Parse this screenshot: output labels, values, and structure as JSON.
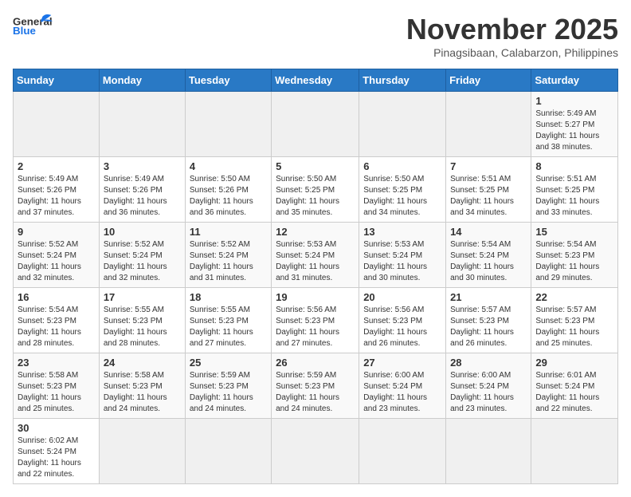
{
  "header": {
    "logo_general": "General",
    "logo_blue": "Blue",
    "month_title": "November 2025",
    "location": "Pinagsibaan, Calabarzon, Philippines"
  },
  "days_of_week": [
    "Sunday",
    "Monday",
    "Tuesday",
    "Wednesday",
    "Thursday",
    "Friday",
    "Saturday"
  ],
  "weeks": [
    [
      {
        "day": "",
        "info": ""
      },
      {
        "day": "",
        "info": ""
      },
      {
        "day": "",
        "info": ""
      },
      {
        "day": "",
        "info": ""
      },
      {
        "day": "",
        "info": ""
      },
      {
        "day": "",
        "info": ""
      },
      {
        "day": "1",
        "info": "Sunrise: 5:49 AM\nSunset: 5:27 PM\nDaylight: 11 hours\nand 38 minutes."
      }
    ],
    [
      {
        "day": "2",
        "info": "Sunrise: 5:49 AM\nSunset: 5:26 PM\nDaylight: 11 hours\nand 37 minutes."
      },
      {
        "day": "3",
        "info": "Sunrise: 5:49 AM\nSunset: 5:26 PM\nDaylight: 11 hours\nand 36 minutes."
      },
      {
        "day": "4",
        "info": "Sunrise: 5:50 AM\nSunset: 5:26 PM\nDaylight: 11 hours\nand 36 minutes."
      },
      {
        "day": "5",
        "info": "Sunrise: 5:50 AM\nSunset: 5:25 PM\nDaylight: 11 hours\nand 35 minutes."
      },
      {
        "day": "6",
        "info": "Sunrise: 5:50 AM\nSunset: 5:25 PM\nDaylight: 11 hours\nand 34 minutes."
      },
      {
        "day": "7",
        "info": "Sunrise: 5:51 AM\nSunset: 5:25 PM\nDaylight: 11 hours\nand 34 minutes."
      },
      {
        "day": "8",
        "info": "Sunrise: 5:51 AM\nSunset: 5:25 PM\nDaylight: 11 hours\nand 33 minutes."
      }
    ],
    [
      {
        "day": "9",
        "info": "Sunrise: 5:52 AM\nSunset: 5:24 PM\nDaylight: 11 hours\nand 32 minutes."
      },
      {
        "day": "10",
        "info": "Sunrise: 5:52 AM\nSunset: 5:24 PM\nDaylight: 11 hours\nand 32 minutes."
      },
      {
        "day": "11",
        "info": "Sunrise: 5:52 AM\nSunset: 5:24 PM\nDaylight: 11 hours\nand 31 minutes."
      },
      {
        "day": "12",
        "info": "Sunrise: 5:53 AM\nSunset: 5:24 PM\nDaylight: 11 hours\nand 31 minutes."
      },
      {
        "day": "13",
        "info": "Sunrise: 5:53 AM\nSunset: 5:24 PM\nDaylight: 11 hours\nand 30 minutes."
      },
      {
        "day": "14",
        "info": "Sunrise: 5:54 AM\nSunset: 5:24 PM\nDaylight: 11 hours\nand 30 minutes."
      },
      {
        "day": "15",
        "info": "Sunrise: 5:54 AM\nSunset: 5:23 PM\nDaylight: 11 hours\nand 29 minutes."
      }
    ],
    [
      {
        "day": "16",
        "info": "Sunrise: 5:54 AM\nSunset: 5:23 PM\nDaylight: 11 hours\nand 28 minutes."
      },
      {
        "day": "17",
        "info": "Sunrise: 5:55 AM\nSunset: 5:23 PM\nDaylight: 11 hours\nand 28 minutes."
      },
      {
        "day": "18",
        "info": "Sunrise: 5:55 AM\nSunset: 5:23 PM\nDaylight: 11 hours\nand 27 minutes."
      },
      {
        "day": "19",
        "info": "Sunrise: 5:56 AM\nSunset: 5:23 PM\nDaylight: 11 hours\nand 27 minutes."
      },
      {
        "day": "20",
        "info": "Sunrise: 5:56 AM\nSunset: 5:23 PM\nDaylight: 11 hours\nand 26 minutes."
      },
      {
        "day": "21",
        "info": "Sunrise: 5:57 AM\nSunset: 5:23 PM\nDaylight: 11 hours\nand 26 minutes."
      },
      {
        "day": "22",
        "info": "Sunrise: 5:57 AM\nSunset: 5:23 PM\nDaylight: 11 hours\nand 25 minutes."
      }
    ],
    [
      {
        "day": "23",
        "info": "Sunrise: 5:58 AM\nSunset: 5:23 PM\nDaylight: 11 hours\nand 25 minutes."
      },
      {
        "day": "24",
        "info": "Sunrise: 5:58 AM\nSunset: 5:23 PM\nDaylight: 11 hours\nand 24 minutes."
      },
      {
        "day": "25",
        "info": "Sunrise: 5:59 AM\nSunset: 5:23 PM\nDaylight: 11 hours\nand 24 minutes."
      },
      {
        "day": "26",
        "info": "Sunrise: 5:59 AM\nSunset: 5:23 PM\nDaylight: 11 hours\nand 24 minutes."
      },
      {
        "day": "27",
        "info": "Sunrise: 6:00 AM\nSunset: 5:24 PM\nDaylight: 11 hours\nand 23 minutes."
      },
      {
        "day": "28",
        "info": "Sunrise: 6:00 AM\nSunset: 5:24 PM\nDaylight: 11 hours\nand 23 minutes."
      },
      {
        "day": "29",
        "info": "Sunrise: 6:01 AM\nSunset: 5:24 PM\nDaylight: 11 hours\nand 22 minutes."
      }
    ],
    [
      {
        "day": "30",
        "info": "Sunrise: 6:02 AM\nSunset: 5:24 PM\nDaylight: 11 hours\nand 22 minutes."
      },
      {
        "day": "",
        "info": ""
      },
      {
        "day": "",
        "info": ""
      },
      {
        "day": "",
        "info": ""
      },
      {
        "day": "",
        "info": ""
      },
      {
        "day": "",
        "info": ""
      },
      {
        "day": "",
        "info": ""
      }
    ]
  ]
}
